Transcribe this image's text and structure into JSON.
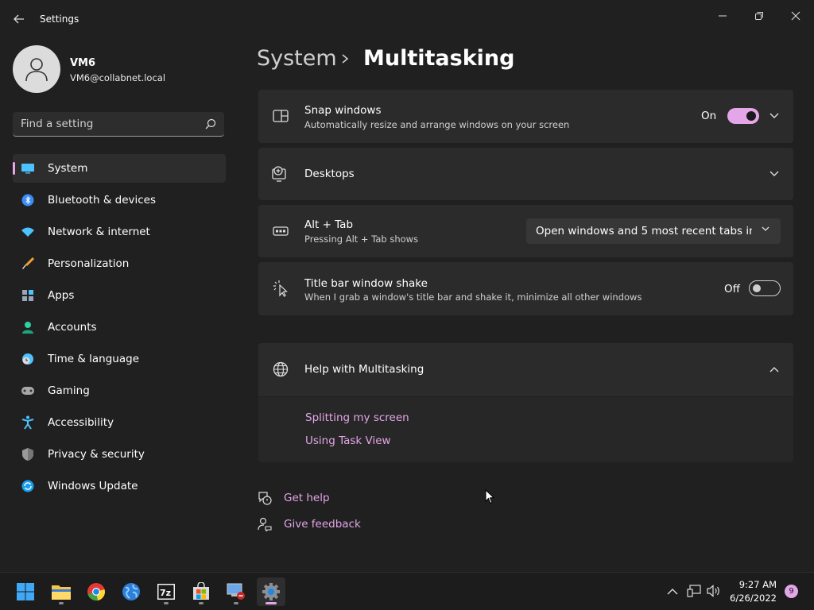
{
  "window": {
    "title": "Settings"
  },
  "user": {
    "name": "VM6",
    "email": "VM6@collabnet.local"
  },
  "search": {
    "placeholder": "Find a setting"
  },
  "sidebar": {
    "items": [
      {
        "label": "System",
        "icon": "monitor-icon",
        "selected": true
      },
      {
        "label": "Bluetooth & devices",
        "icon": "bluetooth-icon"
      },
      {
        "label": "Network & internet",
        "icon": "wifi-icon"
      },
      {
        "label": "Personalization",
        "icon": "brush-icon"
      },
      {
        "label": "Apps",
        "icon": "apps-icon"
      },
      {
        "label": "Accounts",
        "icon": "person-icon"
      },
      {
        "label": "Time & language",
        "icon": "clock-globe-icon"
      },
      {
        "label": "Gaming",
        "icon": "gamepad-icon"
      },
      {
        "label": "Accessibility",
        "icon": "accessibility-icon"
      },
      {
        "label": "Privacy & security",
        "icon": "shield-icon"
      },
      {
        "label": "Windows Update",
        "icon": "update-icon"
      }
    ]
  },
  "breadcrumb": {
    "parent": "System",
    "current": "Multitasking"
  },
  "settings": {
    "snap": {
      "title": "Snap windows",
      "subtitle": "Automatically resize and arrange windows on your screen",
      "state_label": "On",
      "enabled": true
    },
    "desktops": {
      "title": "Desktops"
    },
    "alt_tab": {
      "title": "Alt + Tab",
      "subtitle": "Pressing Alt + Tab shows",
      "value": "Open windows and 5 most recent tabs in M"
    },
    "shake": {
      "title": "Title bar window shake",
      "subtitle": "When I grab a window's title bar and shake it, minimize all other windows",
      "state_label": "Off",
      "enabled": false
    }
  },
  "help": {
    "title": "Help with Multitasking",
    "links": [
      "Splitting my screen",
      "Using Task View"
    ]
  },
  "footer": {
    "get_help": "Get help",
    "give_feedback": "Give feedback"
  },
  "taskbar": {
    "apps": [
      "start-icon",
      "file-explorer-icon",
      "chrome-icon",
      "globe-app-icon",
      "7zip-icon",
      "store-icon",
      "remote-desktop-icon",
      "settings-icon"
    ],
    "time": "9:27 AM",
    "date": "6/26/2022",
    "notifications": "9"
  },
  "colors": {
    "accent": "#e3a6e8",
    "background": "#202020",
    "card": "#2b2b2b"
  }
}
